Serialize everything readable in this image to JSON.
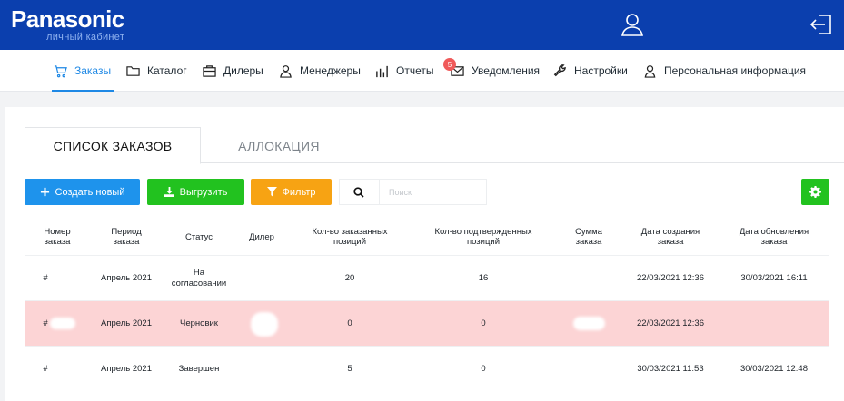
{
  "header": {
    "brand": "Panasonic",
    "subtitle": "личный кабинет",
    "user_icon": "user-icon",
    "logout_icon": "logout-icon"
  },
  "nav": {
    "items": [
      {
        "label": "Заказы",
        "icon": "cart-icon",
        "active": true
      },
      {
        "label": "Каталог",
        "icon": "folder-icon"
      },
      {
        "label": "Дилеры",
        "icon": "briefcase-icon"
      },
      {
        "label": "Менеджеры",
        "icon": "manager-icon"
      },
      {
        "label": "Отчеты",
        "icon": "bar-chart-icon"
      },
      {
        "label": "Уведомления",
        "icon": "envelope-icon",
        "badge": "5"
      },
      {
        "label": "Настройки",
        "icon": "wrench-icon"
      },
      {
        "label": "Персональная информация",
        "icon": "person-icon"
      }
    ]
  },
  "tabs": [
    {
      "label": "СПИСОК ЗАКАЗОВ",
      "active": true
    },
    {
      "label": "АЛЛОКАЦИЯ",
      "active": false
    }
  ],
  "toolbar": {
    "create_label": "Создать новый",
    "export_label": "Выгрузить",
    "filter_label": "Фильтр",
    "search_placeholder": "Поиск"
  },
  "table": {
    "columns": [
      [
        "Номер",
        "заказа"
      ],
      [
        "Период",
        "заказа"
      ],
      [
        "Статус"
      ],
      [
        "Дилер"
      ],
      [
        "Кол-во заказанных",
        "позиций"
      ],
      [
        "Кол-во подтвержденных",
        "позиций"
      ],
      [
        "Сумма",
        "заказа"
      ],
      [
        "Дата создания",
        "заказа"
      ],
      [
        "Дата обновления",
        "заказа"
      ]
    ],
    "rows": [
      {
        "number": "#",
        "period": "Апрель 2021",
        "status": [
          "На",
          "согласовании"
        ],
        "dealer": "",
        "ordered": "20",
        "confirmed": "16",
        "sum": "",
        "created": "22/03/2021 12:36",
        "updated": "30/03/2021 16:11",
        "highlight": false
      },
      {
        "number": "#",
        "period": "Апрель 2021",
        "status": [
          "Черновик"
        ],
        "dealer": "",
        "ordered": "0",
        "confirmed": "0",
        "sum": "",
        "created": "22/03/2021 12:36",
        "updated": "",
        "highlight": true
      },
      {
        "number": "#",
        "period": "Апрель 2021",
        "status": [
          "Завершен"
        ],
        "dealer": "",
        "ordered": "5",
        "confirmed": "0",
        "sum": "",
        "created": "30/03/2021 11:53",
        "updated": "30/03/2021 12:48",
        "highlight": false
      }
    ]
  },
  "colors": {
    "header_bg": "#0b3fae",
    "accent": "#1e88e5",
    "create_btn": "#1e93ec",
    "export_btn": "#22c21f",
    "filter_btn": "#f7a313",
    "highlight_row": "#fcd4d5",
    "badge": "#f05a5a"
  }
}
